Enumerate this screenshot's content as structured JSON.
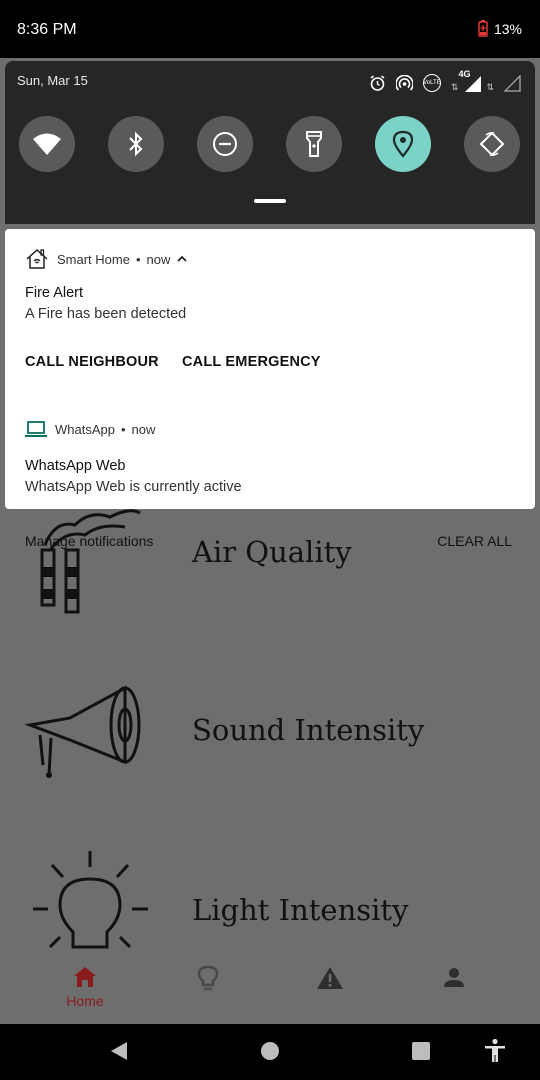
{
  "status_bar": {
    "time": "8:36 PM",
    "battery": "13%"
  },
  "quick_settings": {
    "date": "Sun, Mar 15",
    "network": "4G",
    "volte": "VoLTE",
    "tiles": [
      {
        "icon": "wifi-icon",
        "active": false
      },
      {
        "icon": "bluetooth-icon",
        "active": false
      },
      {
        "icon": "do-not-disturb-icon",
        "active": false
      },
      {
        "icon": "flashlight-icon",
        "active": false
      },
      {
        "icon": "location-icon",
        "active": true
      },
      {
        "icon": "auto-rotate-icon",
        "active": false
      }
    ],
    "active_color": "#7bd2c6"
  },
  "notifications": [
    {
      "app": "Smart Home",
      "time": "now",
      "title": "Fire Alert",
      "text": "A Fire has been detected",
      "actions": [
        "CALL NEIGHBOUR",
        "CALL EMERGENCY"
      ]
    },
    {
      "app": "WhatsApp",
      "time": "now",
      "title": "WhatsApp Web",
      "text": "WhatsApp Web is currently active"
    }
  ],
  "panel": {
    "manage": "Manage notifications",
    "clear_all": "CLEAR ALL"
  },
  "app": {
    "cards": [
      {
        "title": "Air Quality"
      },
      {
        "title": "Sound Intensity"
      },
      {
        "title": "Light Intensity"
      }
    ],
    "bottom_nav": {
      "home_label": "Home",
      "active_color": "#8a1c1c"
    }
  }
}
